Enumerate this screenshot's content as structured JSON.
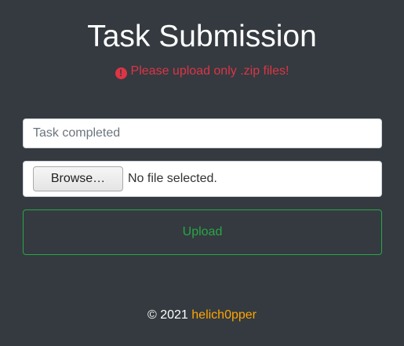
{
  "header": {
    "title": "Task Submission"
  },
  "alert": {
    "icon": "exclamation-circle-icon",
    "icon_glyph": "!",
    "message": "Please upload only .zip files!",
    "color": "#dc3545"
  },
  "form": {
    "task_input": {
      "value": "",
      "placeholder": "Task completed"
    },
    "file_input": {
      "browse_label": "Browse…",
      "status": "No file selected."
    },
    "upload_label": "Upload",
    "upload_color": "#28a745"
  },
  "footer": {
    "copyright": "© 2021",
    "author": "helich0pper",
    "author_color": "#ffa500"
  },
  "theme": {
    "background": "#343a40"
  }
}
